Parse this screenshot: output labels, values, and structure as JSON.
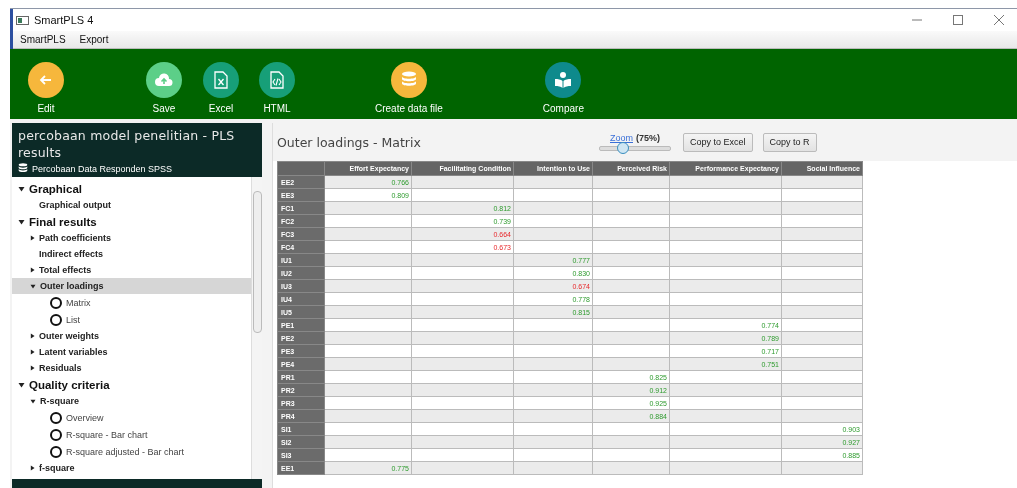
{
  "window": {
    "title": "SmartPLS 4"
  },
  "menu": [
    "SmartPLS",
    "Export"
  ],
  "toolbar": [
    {
      "label": "Edit",
      "color": "#f6b73c"
    },
    {
      "label": "Save",
      "color": "#5ccf88"
    },
    {
      "label": "Excel",
      "color": "#179f78"
    },
    {
      "label": "HTML",
      "color": "#179f78"
    },
    {
      "label": "Create data file",
      "color": "#f6b73c"
    },
    {
      "label": "Compare",
      "color": "#0e8a8c"
    }
  ],
  "sidebar": {
    "title": "percobaan model penelitian - PLS results",
    "dataset": "Percobaan Data Responden SPSS",
    "tree": [
      {
        "label": "Graphical",
        "kind": "group",
        "expanded": true,
        "selected": false,
        "children": [
          {
            "label": "Graphical output",
            "kind": "leaf",
            "selected": false
          }
        ]
      },
      {
        "label": "Final results",
        "kind": "group",
        "expanded": true,
        "selected": false,
        "children": [
          {
            "label": "Path coefficients",
            "kind": "node",
            "expanded": false,
            "selected": false
          },
          {
            "label": "Indirect effects",
            "kind": "leaf",
            "selected": false
          },
          {
            "label": "Total effects",
            "kind": "node",
            "expanded": false,
            "selected": false
          },
          {
            "label": "Outer loadings",
            "kind": "node",
            "expanded": true,
            "selected": true,
            "children": [
              {
                "label": "Matrix",
                "kind": "option",
                "selected": false
              },
              {
                "label": "List",
                "kind": "option",
                "selected": false
              }
            ]
          },
          {
            "label": "Outer weights",
            "kind": "node",
            "expanded": false,
            "selected": false
          },
          {
            "label": "Latent variables",
            "kind": "node",
            "expanded": false,
            "selected": false
          },
          {
            "label": "Residuals",
            "kind": "node",
            "expanded": false,
            "selected": false
          }
        ]
      },
      {
        "label": "Quality criteria",
        "kind": "group",
        "expanded": true,
        "selected": false,
        "children": [
          {
            "label": "R-square",
            "kind": "node",
            "expanded": true,
            "selected": false,
            "children": [
              {
                "label": "Overview",
                "kind": "option",
                "selected": false
              },
              {
                "label": "R-square - Bar chart",
                "kind": "option",
                "selected": false
              },
              {
                "label": "R-square adjusted - Bar chart",
                "kind": "option",
                "selected": false
              }
            ]
          },
          {
            "label": "f-square",
            "kind": "node",
            "expanded": false,
            "selected": false
          }
        ]
      }
    ]
  },
  "content": {
    "title": "Outer loadings - Matrix",
    "zoom": {
      "label": "Zoom",
      "value": "(75%)",
      "level": 0.33
    },
    "buttons": [
      "Copy to Excel",
      "Copy to R"
    ],
    "table": {
      "columns": [
        "Effort Expectancy",
        "Facilitating Condition",
        "Intention to Use",
        "Perceived Risk",
        "Performance Expectancy",
        "Social Influence"
      ],
      "rows": [
        {
          "label": "EE2",
          "column_1": "0.766",
          "below_threshold": false
        },
        {
          "label": "EE3",
          "column_1": "0.809",
          "below_threshold": false
        },
        {
          "label": "FC1",
          "column_2": "0.812",
          "below_threshold": false
        },
        {
          "label": "FC2",
          "column_2": "0.739",
          "below_threshold": false
        },
        {
          "label": "FC3",
          "column_2": "0.664",
          "below_threshold": true
        },
        {
          "label": "FC4",
          "column_2": "0.673",
          "below_threshold": true
        },
        {
          "label": "IU1",
          "column_3": "0.777",
          "below_threshold": false
        },
        {
          "label": "IU2",
          "column_3": "0.830",
          "below_threshold": false
        },
        {
          "label": "IU3",
          "column_3": "0.674",
          "below_threshold": true
        },
        {
          "label": "IU4",
          "column_3": "0.778",
          "below_threshold": false
        },
        {
          "label": "IU5",
          "column_3": "0.815",
          "below_threshold": false
        },
        {
          "label": "PE1",
          "column_5": "0.774",
          "below_threshold": false
        },
        {
          "label": "PE2",
          "column_5": "0.789",
          "below_threshold": false
        },
        {
          "label": "PE3",
          "column_5": "0.717",
          "below_threshold": false
        },
        {
          "label": "PE4",
          "column_5": "0.751",
          "below_threshold": false
        },
        {
          "label": "PR1",
          "column_4": "0.825",
          "below_threshold": false
        },
        {
          "label": "PR2",
          "column_4": "0.912",
          "below_threshold": false
        },
        {
          "label": "PR3",
          "column_4": "0.925",
          "below_threshold": false
        },
        {
          "label": "PR4",
          "column_4": "0.884",
          "below_threshold": false
        },
        {
          "label": "SI1",
          "column_6": "0.903",
          "below_threshold": false
        },
        {
          "label": "SI2",
          "column_6": "0.927",
          "below_threshold": false
        },
        {
          "label": "SI3",
          "column_6": "0.885",
          "below_threshold": false
        },
        {
          "label": "EE1",
          "column_1": "0.775",
          "below_threshold": false
        }
      ]
    }
  }
}
